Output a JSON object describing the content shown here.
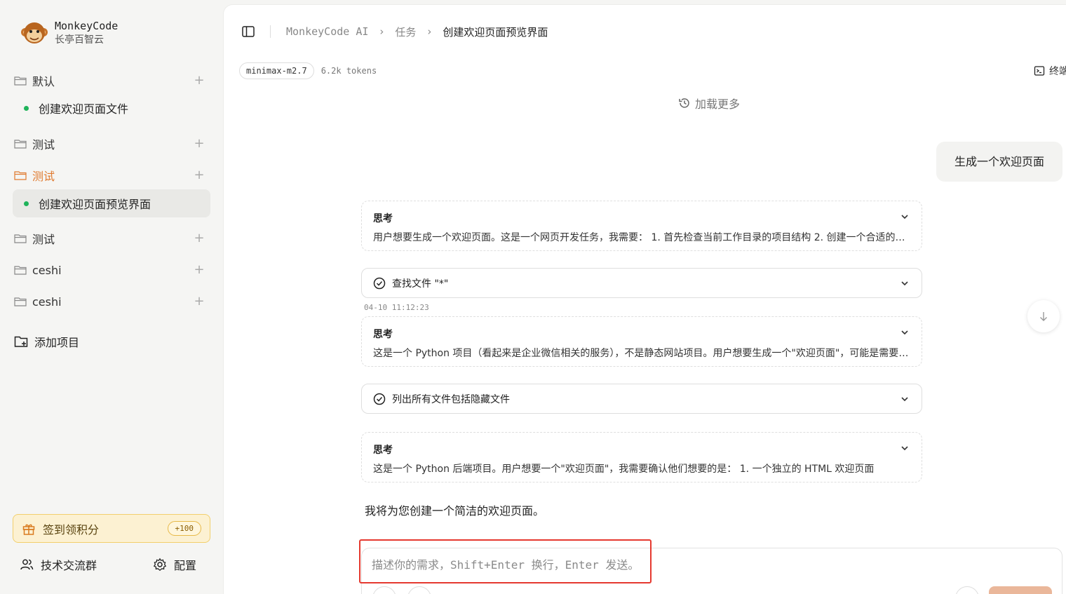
{
  "brand": {
    "name": "MonkeyCode",
    "subtitle": "长亭百智云"
  },
  "sidebar": {
    "groups": [
      {
        "label": "默认"
      },
      {
        "label": "测试"
      },
      {
        "label": "测试"
      },
      {
        "label": "测试"
      },
      {
        "label": "ceshi"
      },
      {
        "label": "ceshi"
      }
    ],
    "tasks": [
      {
        "label": "创建欢迎页面文件"
      },
      {
        "label": "创建欢迎页面预览界面"
      }
    ],
    "add_project": "添加项目",
    "checkin": {
      "label": "签到领积分",
      "badge": "+100"
    },
    "community": "技术交流群",
    "settings": "配置"
  },
  "breadcrumb": {
    "root": "MonkeyCode AI",
    "section": "任务",
    "current": "创建欢迎页面预览界面"
  },
  "model": {
    "name": "minimax-m2.7",
    "tokens": "6.2k tokens"
  },
  "terminal_label": "终端",
  "load_more": "加载更多",
  "messages": {
    "user": "生成一个欢迎页面",
    "think_title": "思考",
    "think1": "用户想要生成一个欢迎页面。这是一个网页开发任务，我需要： 1. 首先检查当前工作目录的项目结构 2. 创建一个合适的欢迎页面",
    "tool1": "查找文件 \"*\"",
    "timestamp": "04-10 11:12:23",
    "think2": "这是一个 Python 项目（看起来是企业微信相关的服务），不是静态网站项目。用户想要生成一个\"欢迎页面\"，可能是需要一个简单的页面",
    "tool2": "列出所有文件包括隐藏文件",
    "think3": "这是一个 Python 后端项目。用户想要一个\"欢迎页面\"，我需要确认他们想要的是： 1. 一个独立的 HTML 欢迎页面",
    "assistant": "我将为您创建一个简洁的欢迎页面。"
  },
  "composer": {
    "placeholder": "描述你的需求，Shift+Enter 换行，Enter 发送。"
  },
  "colors": {
    "accent": "#e07a2f",
    "status_dot": "#1fb35a",
    "highlight": "#e5392f"
  }
}
